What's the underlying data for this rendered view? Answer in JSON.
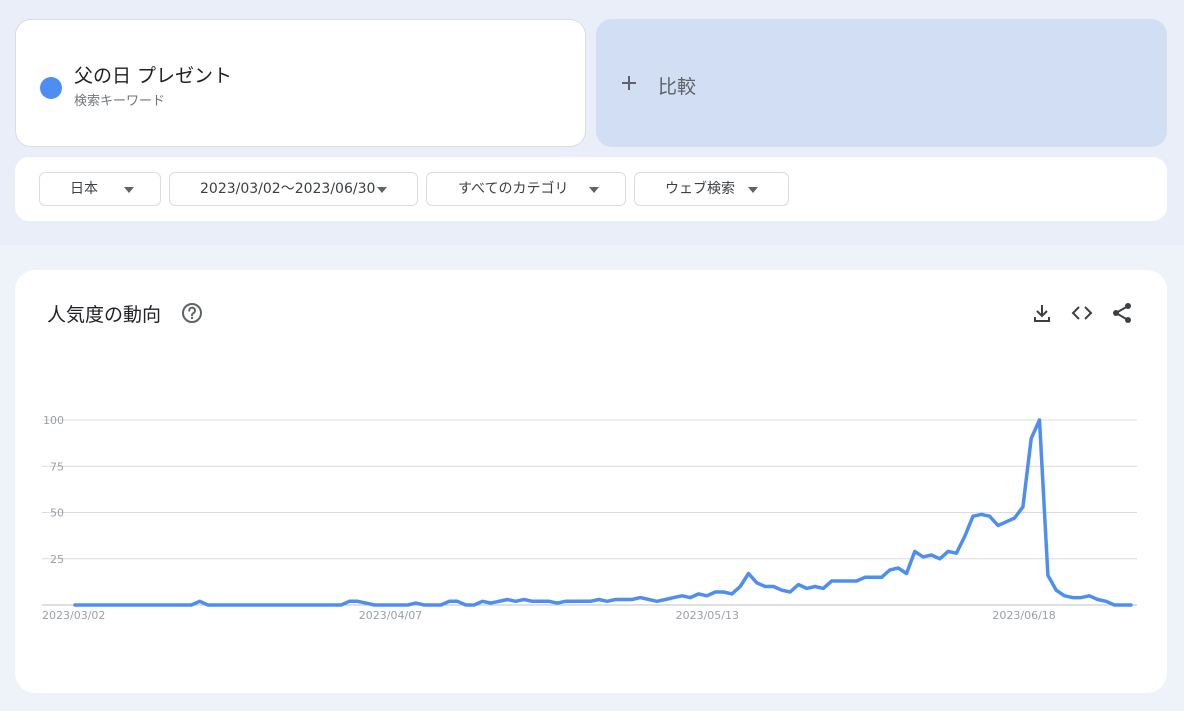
{
  "term": {
    "title": "父の日 プレゼント",
    "subtitle": "検索キーワード",
    "color": "#4f8ef1"
  },
  "compare": {
    "plus_icon": "plus-icon",
    "label": "比較"
  },
  "filters": {
    "region": "日本",
    "date_range": "2023/03/02〜2023/06/30",
    "category": "すべてのカテゴリ",
    "search_type": "ウェブ検索"
  },
  "panel": {
    "title": "人気度の動向",
    "help_icon": "help-icon",
    "download_icon": "download-icon",
    "embed_icon": "embed-icon",
    "share_icon": "share-icon"
  },
  "chart_data": {
    "type": "line",
    "title": "",
    "xlabel": "",
    "ylabel": "",
    "ylim": [
      0,
      100
    ],
    "y_ticks": [
      25,
      50,
      75,
      100
    ],
    "x_ticks": [
      "2023/03/02",
      "2023/04/07",
      "2023/05/13",
      "2023/06/18"
    ],
    "x_start": "2023/03/02",
    "x_end": "2023/06/30",
    "grid": true,
    "line_color": "#4f8ef1",
    "series": [
      {
        "values": [
          0,
          0,
          0,
          0,
          0,
          0,
          0,
          0,
          0,
          0,
          0,
          0,
          0,
          0,
          0,
          2,
          0,
          0,
          0,
          0,
          0,
          0,
          0,
          0,
          0,
          0,
          0,
          0,
          0,
          0,
          0,
          0,
          0,
          2,
          2,
          1,
          0,
          0,
          0,
          0,
          0,
          1,
          0,
          0,
          0,
          2,
          2,
          0,
          0,
          2,
          1,
          2,
          3,
          2,
          3,
          2,
          2,
          2,
          1,
          2,
          2,
          2,
          2,
          3,
          2,
          3,
          3,
          3,
          4,
          3,
          2,
          3,
          4,
          5,
          4,
          6,
          5,
          7,
          7,
          6,
          10,
          17,
          12,
          10,
          10,
          8,
          7,
          11,
          9,
          10,
          9,
          13,
          13,
          13,
          13,
          15,
          15,
          15,
          19,
          20,
          17,
          29,
          26,
          27,
          25,
          29,
          28,
          37,
          48,
          49,
          48,
          43,
          45,
          47,
          53,
          90,
          100,
          16,
          8,
          5,
          4,
          4,
          5,
          3,
          2,
          0,
          0,
          0
        ]
      }
    ]
  }
}
